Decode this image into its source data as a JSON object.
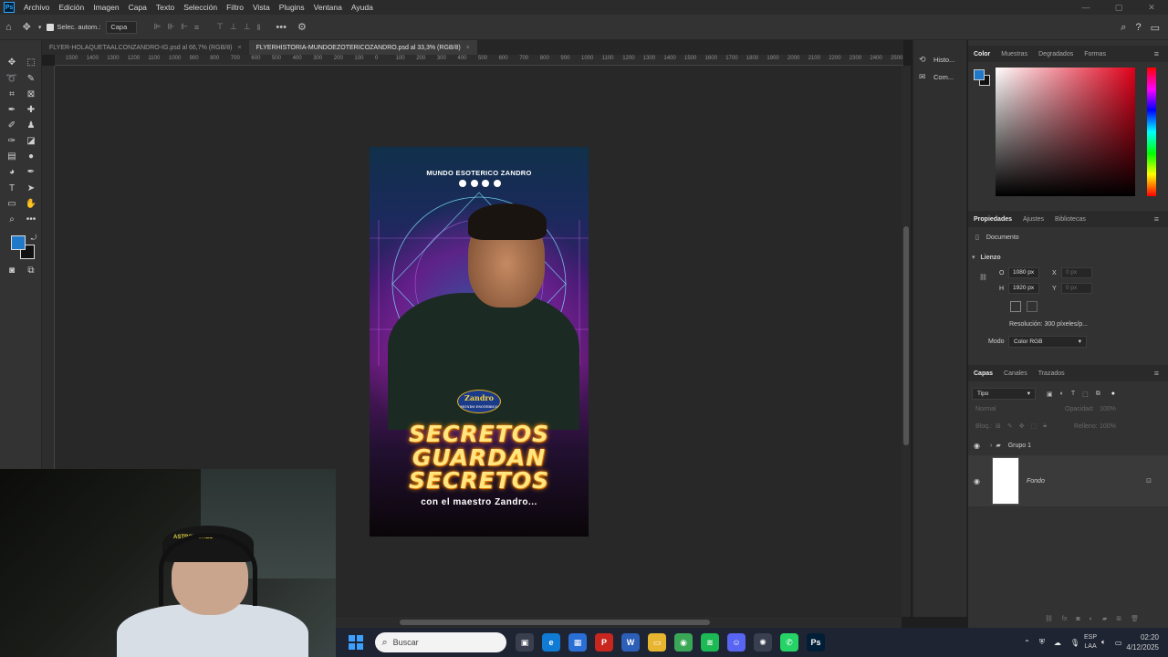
{
  "menubar": {
    "items": [
      "Archivo",
      "Edición",
      "Imagen",
      "Capa",
      "Texto",
      "Selección",
      "Filtro",
      "Vista",
      "Plugins",
      "Ventana",
      "Ayuda"
    ]
  },
  "options": {
    "auto_select_label": "Selec. autom.:",
    "auto_select_value": "Capa"
  },
  "tabs": [
    {
      "label": "FLYER-HOLAQUETAALCONZANDRO-IG.psd al 66,7% (RGB/8)",
      "active": false
    },
    {
      "label": "FLYERHISTORIA-MUNDOEZOTERICOZANDRO.psd al 33,3% (RGB/8)",
      "active": true
    }
  ],
  "ruler": {
    "ticks": [
      "1500",
      "1400",
      "1300",
      "1200",
      "1100",
      "1000",
      "900",
      "800",
      "700",
      "600",
      "500",
      "400",
      "300",
      "200",
      "100",
      "0",
      "100",
      "200",
      "300",
      "400",
      "500",
      "600",
      "700",
      "800",
      "900",
      "1000",
      "1100",
      "1200",
      "1300",
      "1400",
      "1500",
      "1600",
      "1700",
      "1800",
      "1900",
      "2000",
      "2100",
      "2200",
      "2300",
      "2400",
      "2500"
    ]
  },
  "document": {
    "brand": "MUNDO ESOTERICO ZANDRO",
    "badge_name": "Zandro",
    "badge_sub": "MUNDO ESOTERICO",
    "headline": [
      "SECRETOS",
      "GUARDAN",
      "SECRETOS"
    ],
    "subline": "con el maestro Zandro..."
  },
  "collapsed_panels": [
    {
      "label": "Histo...",
      "icon": "history-icon"
    },
    {
      "label": "Com...",
      "icon": "comments-icon"
    }
  ],
  "color_panel": {
    "tabs": [
      "Color",
      "Muestras",
      "Degradados",
      "Formas"
    ],
    "foreground": "#1f78c8",
    "background": "#111111"
  },
  "properties": {
    "tabs": [
      "Propiedades",
      "Ajustes",
      "Bibliotecas"
    ],
    "kind": "Documento",
    "section": "Lienzo",
    "width_label": "O",
    "width": "1080 px",
    "height_label": "H",
    "height": "1920 px",
    "x_label": "X",
    "x_placeholder": "0 px",
    "y_label": "Y",
    "y_placeholder": "0 px",
    "resolution": "Resolución:  300 píxeles/p...",
    "mode_label": "Modo",
    "mode_value": "Color RGB"
  },
  "layers": {
    "tabs": [
      "Capas",
      "Canales",
      "Trazados"
    ],
    "filter_value": "Tipo",
    "blend": "Normal",
    "opacity_label": "Opacidad:",
    "opacity_value": "100%",
    "lock_label": "Bloq.:",
    "fill_label": "Relleno:",
    "fill_value": "100%",
    "items": [
      {
        "name": "Grupo 1",
        "type": "group"
      },
      {
        "name": "Fondo",
        "type": "background"
      }
    ]
  },
  "webcam": {
    "cap_text": "ASTROWORLD"
  },
  "taskbar": {
    "search_placeholder": "Buscar",
    "lang_top": "ESP",
    "lang_bottom": "LAA",
    "time": "02:20",
    "date": "4/12/2025",
    "apps": [
      {
        "name": "task-view",
        "color": "#3a3f4f",
        "glyph": "▣"
      },
      {
        "name": "edge",
        "color": "#0f7bd4",
        "glyph": "e"
      },
      {
        "name": "store",
        "color": "#2a6fd6",
        "glyph": "▦"
      },
      {
        "name": "acrobat",
        "color": "#c8261e",
        "glyph": "P"
      },
      {
        "name": "word",
        "color": "#2b5fb8",
        "glyph": "W"
      },
      {
        "name": "explorer",
        "color": "#e8b530",
        "glyph": "▭"
      },
      {
        "name": "chrome",
        "color": "#3aa757",
        "glyph": "◉"
      },
      {
        "name": "spotify",
        "color": "#1db954",
        "glyph": "≋"
      },
      {
        "name": "discord",
        "color": "#5865f2",
        "glyph": "☺"
      },
      {
        "name": "chatgpt",
        "color": "#3a3f4f",
        "glyph": "✺"
      },
      {
        "name": "whatsapp",
        "color": "#25d366",
        "glyph": "✆"
      },
      {
        "name": "photoshop",
        "color": "#001e36",
        "glyph": "Ps"
      }
    ]
  }
}
